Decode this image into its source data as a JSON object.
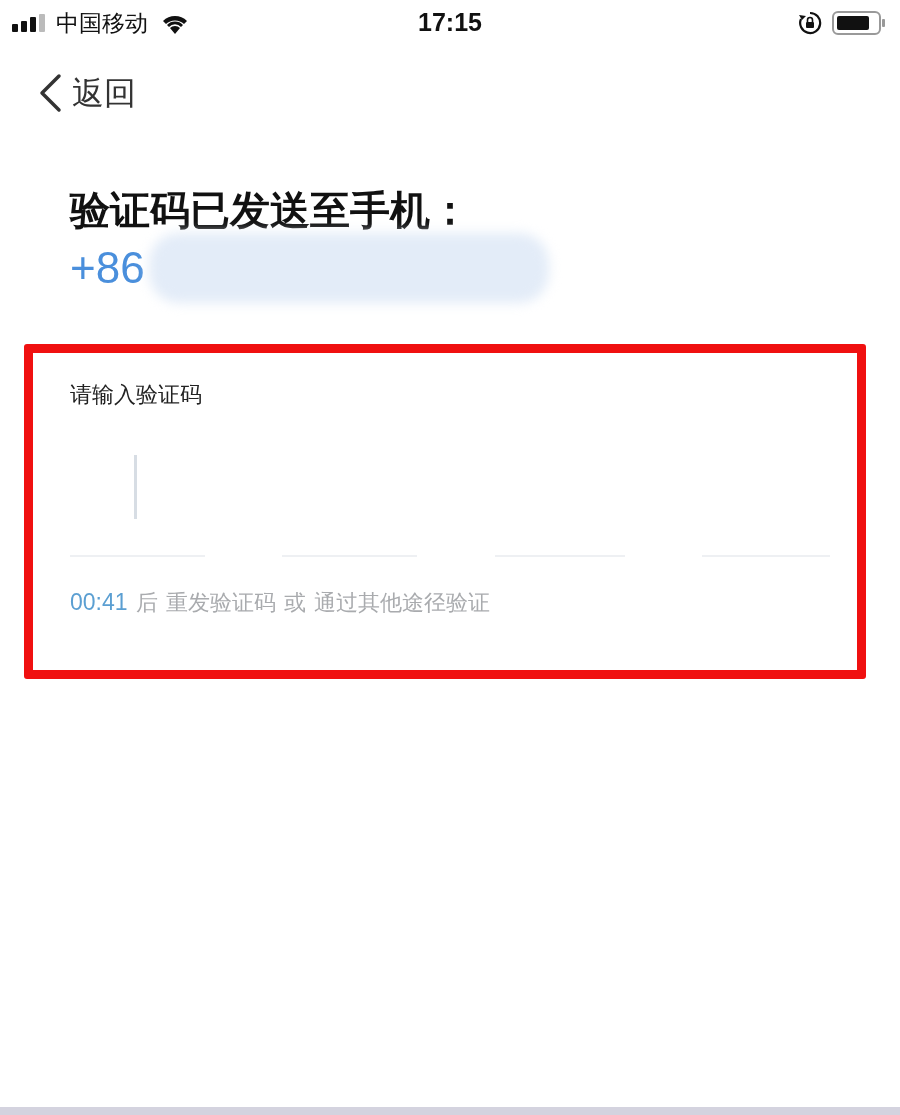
{
  "status_bar": {
    "carrier": "中国移动",
    "time": "17:15"
  },
  "nav": {
    "back_label": "返回"
  },
  "title": "验证码已发送至手机：",
  "phone": {
    "prefix": "+86",
    "redacted": true
  },
  "code_entry": {
    "label": "请输入验证码",
    "slots": [
      {
        "focused": true
      },
      {
        "focused": false
      },
      {
        "focused": false
      },
      {
        "focused": false
      }
    ],
    "hint": [
      {
        "kind": "countdown",
        "text": "00:41"
      },
      {
        "kind": "text",
        "text": "后"
      },
      {
        "kind": "text",
        "text": "重发验证码"
      },
      {
        "kind": "text",
        "text": "或"
      },
      {
        "kind": "text",
        "text": "通过其他途径验证"
      }
    ]
  }
}
